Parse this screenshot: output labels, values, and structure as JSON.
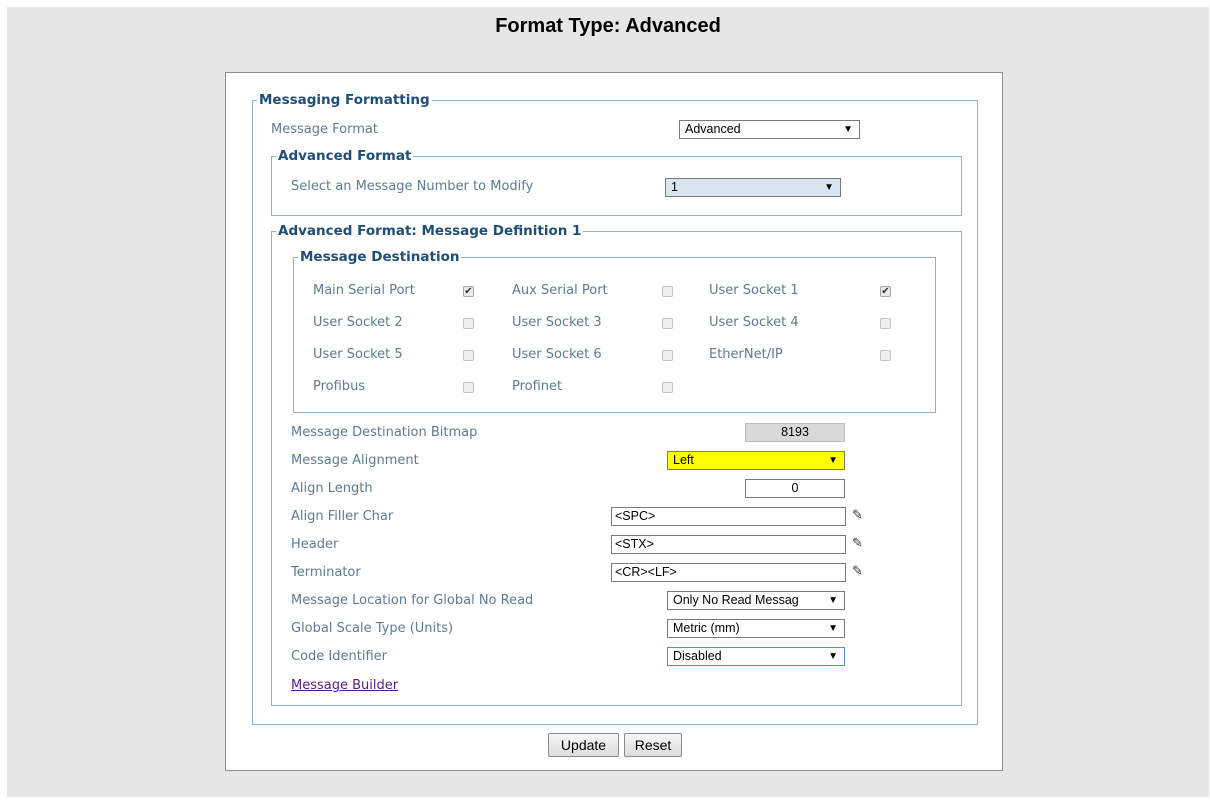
{
  "page_title": "Format Type: Advanced",
  "messaging_formatting": {
    "legend": "Messaging Formatting",
    "message_format_label": "Message Format",
    "message_format_value": "Advanced"
  },
  "advanced_format": {
    "legend": "Advanced Format",
    "select_label": "Select an Message Number to Modify",
    "select_value": "1"
  },
  "message_definition": {
    "legend": "Advanced Format: Message Definition 1",
    "destination": {
      "legend": "Message Destination",
      "items": [
        {
          "label": "Main Serial Port",
          "checked": true
        },
        {
          "label": "Aux Serial Port",
          "checked": false
        },
        {
          "label": "User Socket 1",
          "checked": true
        },
        {
          "label": "User Socket 2",
          "checked": false
        },
        {
          "label": "User Socket 3",
          "checked": false
        },
        {
          "label": "User Socket 4",
          "checked": false
        },
        {
          "label": "User Socket 5",
          "checked": false
        },
        {
          "label": "User Socket 6",
          "checked": false
        },
        {
          "label": "EtherNet/IP",
          "checked": false
        },
        {
          "label": "Profibus",
          "checked": false
        },
        {
          "label": "Profinet",
          "checked": false
        }
      ]
    },
    "bitmap_label": "Message Destination Bitmap",
    "bitmap_value": "8193",
    "alignment_label": "Message Alignment",
    "alignment_value": "Left",
    "align_length_label": "Align Length",
    "align_length_value": "0",
    "filler_label": "Align Filler Char",
    "filler_value": "<SPC>",
    "header_label": "Header",
    "header_value": "<STX>",
    "terminator_label": "Terminator",
    "terminator_value": "<CR><LF>",
    "location_label": "Message Location for Global No Read",
    "location_value": "Only No Read Messag",
    "scale_label": "Global Scale Type (Units)",
    "scale_value": "Metric (mm)",
    "code_id_label": "Code Identifier",
    "code_id_value": "Disabled",
    "builder_link": "Message Builder"
  },
  "buttons": {
    "update": "Update",
    "reset": "Reset"
  },
  "colors": {
    "highlight": "#ffff00",
    "readonly": "#d9d9d9",
    "selected_number": "#dbe5f1",
    "legend_text": "#1f4e78",
    "label_text": "#5d7b96"
  }
}
